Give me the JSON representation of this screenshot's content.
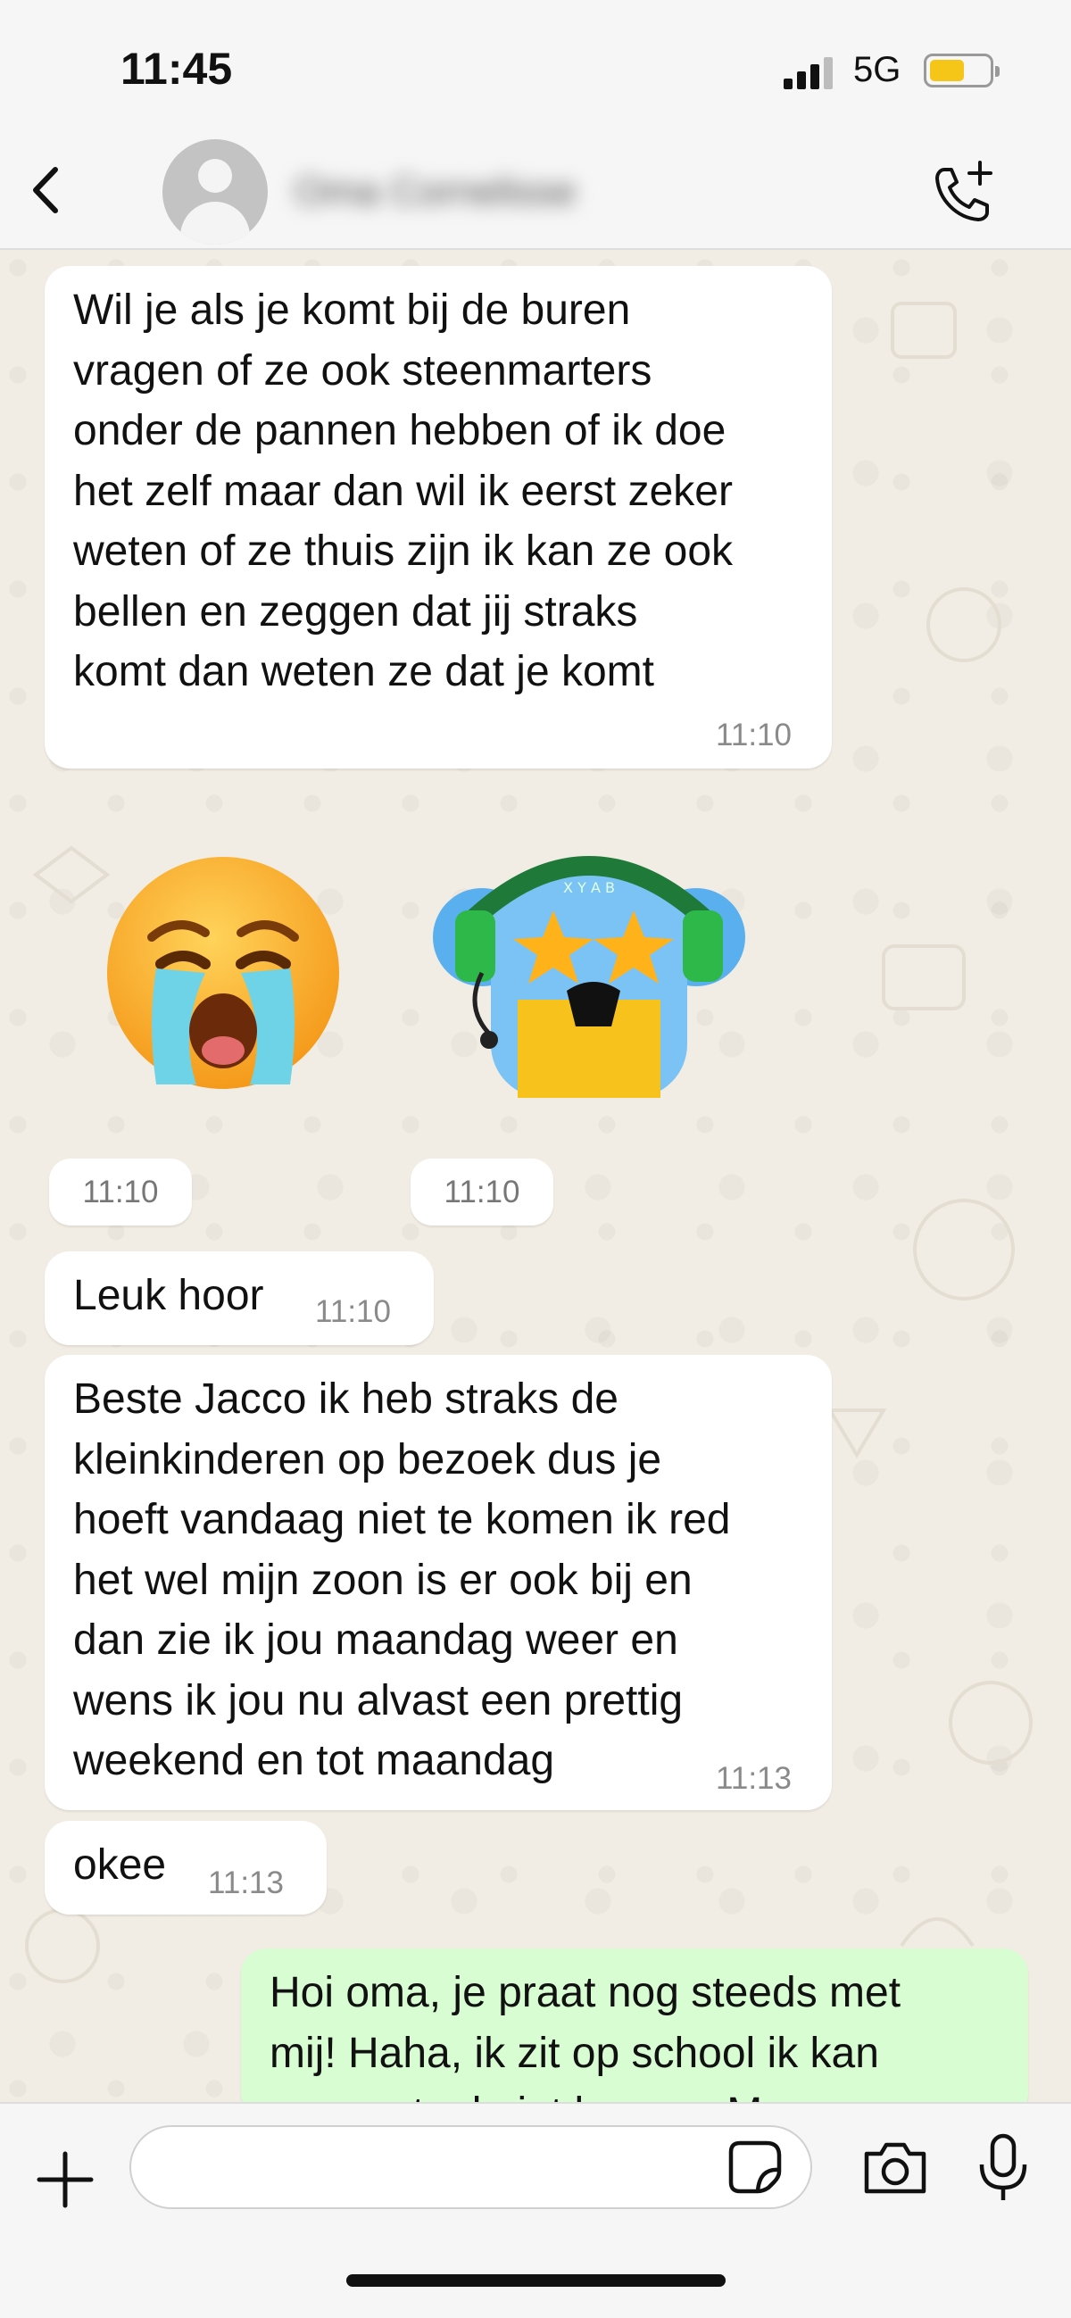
{
  "status_bar": {
    "time": "11:45",
    "network": "5G",
    "signal_bars_active": 3,
    "signal_bars_total": 4,
    "battery_level": 0.5,
    "battery_color": "#f5c518"
  },
  "header": {
    "contact_name": "Oma Cornelisse",
    "icons": {
      "back": "chevron-left-icon",
      "call": "add-call-icon"
    }
  },
  "messages": [
    {
      "direction": "incoming",
      "text": "Wil je als je komt bij de buren\nvragen of ze ook steenmarters\nonder de pannen hebben of ik doe\nhet zelf maar dan wil ik eerst zeker\nweten of ze thuis zijn ik kan ze ook\nbellen en zeggen dat jij straks\nkomt dan weten ze dat je komt",
      "time": "11:10"
    },
    {
      "direction": "incoming",
      "type": "sticker",
      "sticker": "crying-face-emoji",
      "time": "11:10"
    },
    {
      "direction": "incoming",
      "type": "sticker",
      "sticker": "koala-gamer-sticker",
      "sticker_text": "X Y A B",
      "time": "11:10"
    },
    {
      "direction": "incoming",
      "text": "Leuk hoor",
      "time": "11:10"
    },
    {
      "direction": "incoming",
      "text": "Beste Jacco ik heb straks de\nkleinkinderen op bezoek dus je\nhoeft vandaag niet te komen ik red\nhet wel mijn zoon is er ook bij en\ndan zie ik jou maandag weer en\nwens ik jou nu alvast een prettig\nweekend en tot maandag",
      "time": "11:13"
    },
    {
      "direction": "incoming",
      "text": "okee",
      "time": "11:13"
    },
    {
      "direction": "outgoing",
      "text": "Hoi oma, je praat nog steeds met\nmij! Haha, ik zit op school ik kan\nmomenteel niet komen. Maar",
      "time": ""
    }
  ],
  "input_bar": {
    "placeholder": "",
    "icons": {
      "attach": "plus-icon",
      "sticker": "sticker-icon",
      "camera": "camera-icon",
      "mic": "microphone-icon"
    }
  },
  "colors": {
    "incoming_bubble": "#ffffff",
    "outgoing_bubble": "#d8fdd2",
    "wallpaper": "#f2ede4"
  }
}
